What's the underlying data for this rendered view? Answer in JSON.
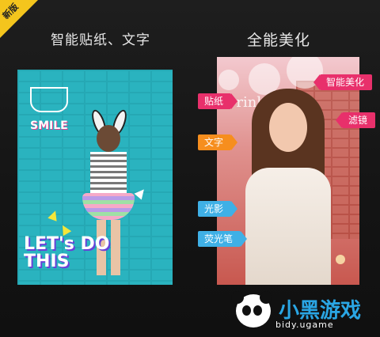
{
  "badge": {
    "label": "新版"
  },
  "left_panel": {
    "caption": "智能贴纸、文字",
    "sticker_text": "SMILE",
    "headline": "LET's DO THIS"
  },
  "right_panel": {
    "caption": "全能美化",
    "poster_text": "Drink",
    "tags": [
      {
        "label": "贴纸"
      },
      {
        "label": "智能美化"
      },
      {
        "label": "滤镜"
      },
      {
        "label": "文字"
      },
      {
        "label": "光影"
      },
      {
        "label": "荧光笔"
      }
    ]
  },
  "watermark": {
    "logo": "小黑游戏",
    "url": "bidy.ugame"
  },
  "colors": {
    "badge": "#f4c51d",
    "tag_red": "#e8306b",
    "tag_orange": "#f68e1e",
    "tag_blue": "#3fb0e6"
  }
}
